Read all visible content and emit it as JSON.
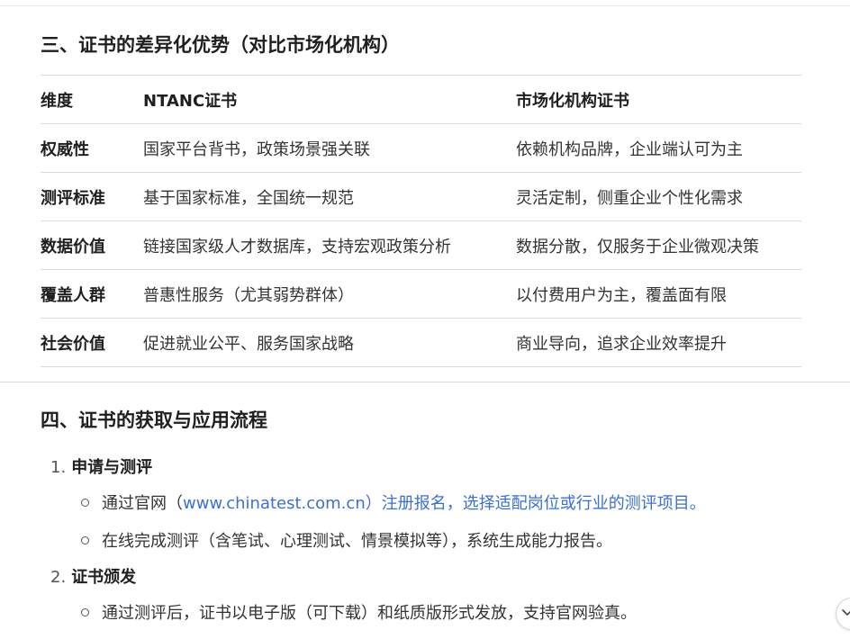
{
  "section3": {
    "title": "三、证书的差异化优势（对比市场化机构）",
    "table": {
      "headers": [
        "维度",
        "NTANC证书",
        "市场化机构证书"
      ],
      "rows": [
        {
          "dimension": "权威性",
          "ntanc": "国家平台背书，政策场景强关联",
          "market": "依赖机构品牌，企业端认可为主"
        },
        {
          "dimension": "测评标准",
          "ntanc": "基于国家标准，全国统一规范",
          "market": "灵活定制，侧重企业个性化需求"
        },
        {
          "dimension": "数据价值",
          "ntanc": "链接国家级人才数据库，支持宏观政策分析",
          "market": "数据分散，仅服务于企业微观决策"
        },
        {
          "dimension": "覆盖人群",
          "ntanc": "普惠性服务（尤其弱势群体）",
          "market": "以付费用户为主，覆盖面有限"
        },
        {
          "dimension": "社会价值",
          "ntanc": "促进就业公平、服务国家战略",
          "market": "商业导向，追求企业效率提升"
        }
      ]
    }
  },
  "section4": {
    "title": "四、证书的获取与应用流程",
    "steps": [
      {
        "number": "1.",
        "label": "申请与测评",
        "items": [
          {
            "prefix": "通过官网（",
            "link": "www.chinatest.com.cn）注册报名，选择适配岗位或行业的测评项目。"
          },
          {
            "text": "在线完成测评（含笔试、心理测试、情景模拟等），系统生成能力报告。"
          }
        ]
      },
      {
        "number": "2.",
        "label": "证书颁发",
        "items": [
          {
            "text": "通过测评后，证书以电子版（可下载）和纸质版形式发放，支持官网验真。"
          }
        ]
      }
    ]
  },
  "scroll_button": {
    "icon": "chevron-down-icon"
  },
  "colors": {
    "link": "#3b6fd8",
    "rule": "#dcdcdc",
    "text": "#262626"
  }
}
